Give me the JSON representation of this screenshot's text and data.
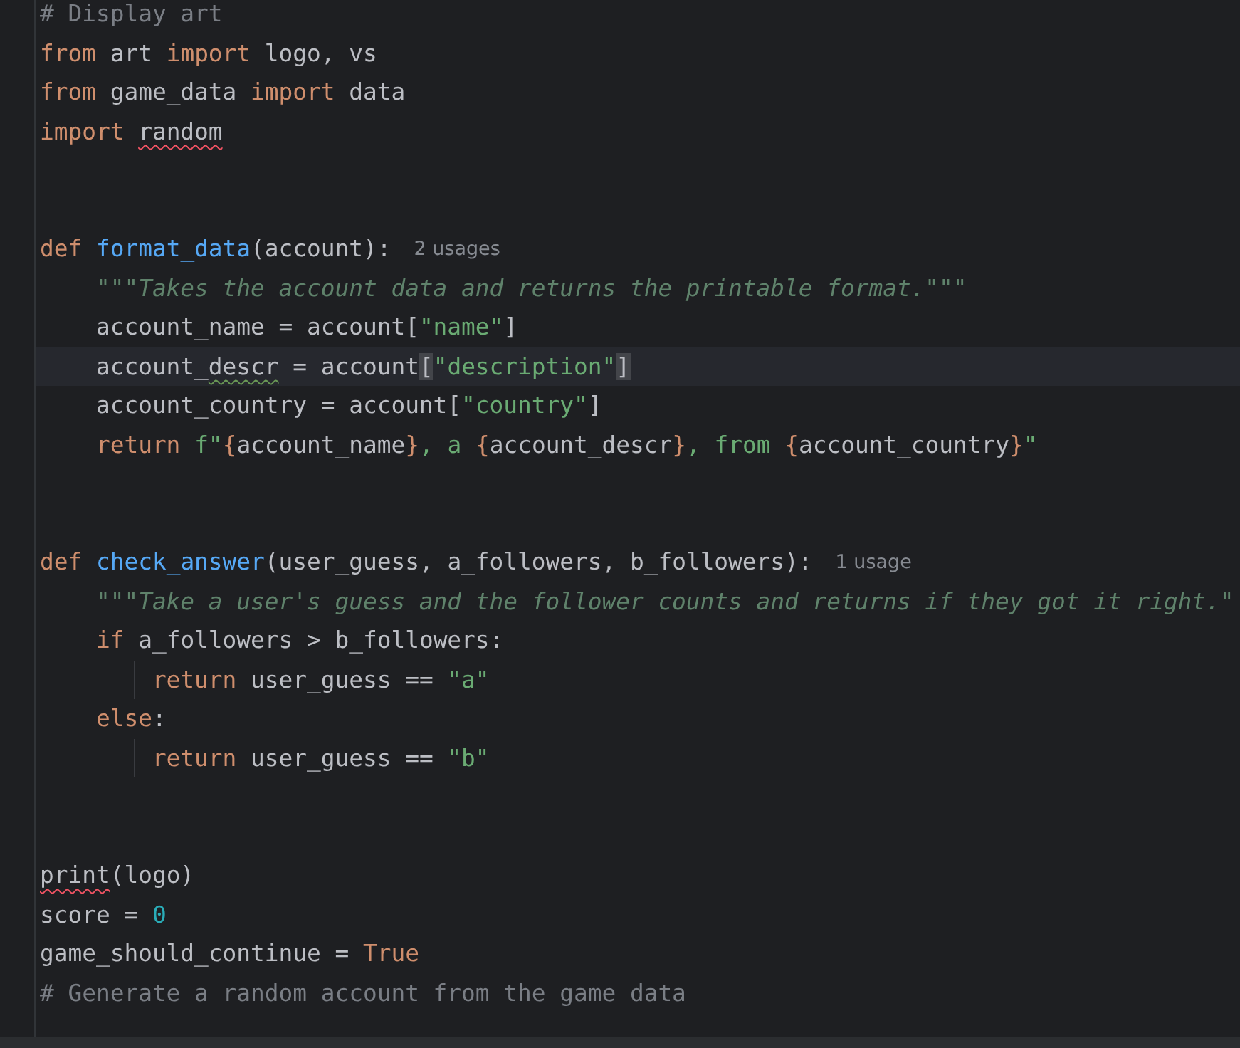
{
  "editor": {
    "lines": [
      {
        "kind": "code",
        "tokens": [
          {
            "kind": "comment",
            "text": "# Display art"
          }
        ]
      },
      {
        "kind": "code",
        "tokens": [
          {
            "kind": "keyword",
            "text": "from"
          },
          {
            "kind": "plain",
            "text": " art "
          },
          {
            "kind": "keyword",
            "text": "import"
          },
          {
            "kind": "plain",
            "text": " logo, vs"
          }
        ]
      },
      {
        "kind": "code",
        "tokens": [
          {
            "kind": "keyword",
            "text": "from"
          },
          {
            "kind": "plain",
            "text": " game_data "
          },
          {
            "kind": "keyword",
            "text": "import"
          },
          {
            "kind": "plain",
            "text": " data"
          }
        ]
      },
      {
        "kind": "code",
        "tokens": [
          {
            "kind": "keyword",
            "text": "import "
          },
          {
            "kind": "plain",
            "text": "random",
            "error": true
          }
        ]
      },
      {
        "kind": "blank"
      },
      {
        "kind": "blank"
      },
      {
        "kind": "code",
        "tokens": [
          {
            "kind": "keyword",
            "text": "def "
          },
          {
            "kind": "function",
            "text": "format_data"
          },
          {
            "kind": "plain",
            "text": "(account):"
          }
        ],
        "hint": "2 usages"
      },
      {
        "kind": "code",
        "tokens": [
          {
            "kind": "docstring",
            "text": "    \"\"\"Takes the account data and returns the printable format.\"\"\""
          }
        ]
      },
      {
        "kind": "code",
        "tokens": [
          {
            "kind": "plain",
            "text": "    account_name = account["
          },
          {
            "kind": "string",
            "text": "\"name\""
          },
          {
            "kind": "plain",
            "text": "]"
          }
        ]
      },
      {
        "kind": "code",
        "current": true,
        "tokens": [
          {
            "kind": "plain",
            "text": "    account_"
          },
          {
            "kind": "plain",
            "text": "descr",
            "warning": true
          },
          {
            "kind": "plain",
            "text": " = account"
          },
          {
            "kind": "matched",
            "text": "["
          },
          {
            "kind": "string",
            "text": "\"description\""
          },
          {
            "kind": "matched",
            "text": "]"
          }
        ]
      },
      {
        "kind": "code",
        "tokens": [
          {
            "kind": "plain",
            "text": "    account_country = account["
          },
          {
            "kind": "string",
            "text": "\"country\""
          },
          {
            "kind": "plain",
            "text": "]"
          }
        ]
      },
      {
        "kind": "code",
        "tokens": [
          {
            "kind": "keyword",
            "text": "    return "
          },
          {
            "kind": "string",
            "text": "f\""
          },
          {
            "kind": "brace",
            "text": "{"
          },
          {
            "kind": "plain",
            "text": "account_name"
          },
          {
            "kind": "brace",
            "text": "}"
          },
          {
            "kind": "string",
            "text": ", a "
          },
          {
            "kind": "brace",
            "text": "{"
          },
          {
            "kind": "plain",
            "text": "account_descr"
          },
          {
            "kind": "brace",
            "text": "}"
          },
          {
            "kind": "string",
            "text": ", from "
          },
          {
            "kind": "brace",
            "text": "{"
          },
          {
            "kind": "plain",
            "text": "account_country"
          },
          {
            "kind": "brace",
            "text": "}"
          },
          {
            "kind": "string",
            "text": "\""
          }
        ]
      },
      {
        "kind": "blank"
      },
      {
        "kind": "blank"
      },
      {
        "kind": "code",
        "tokens": [
          {
            "kind": "keyword",
            "text": "def "
          },
          {
            "kind": "function",
            "text": "check_answer"
          },
          {
            "kind": "plain",
            "text": "(user_guess, a_followers, b_followers):"
          }
        ],
        "hint": "1 usage"
      },
      {
        "kind": "code",
        "tokens": [
          {
            "kind": "docstring",
            "text": "    \"\"\"Take a user's guess and the follower counts and returns if they got it right.\""
          }
        ]
      },
      {
        "kind": "code",
        "tokens": [
          {
            "kind": "keyword",
            "text": "    if"
          },
          {
            "kind": "plain",
            "text": " a_followers > b_followers:"
          }
        ]
      },
      {
        "kind": "code",
        "guide": true,
        "tokens": [
          {
            "kind": "keyword",
            "text": "        return"
          },
          {
            "kind": "plain",
            "text": " user_guess == "
          },
          {
            "kind": "string",
            "text": "\"a\""
          }
        ]
      },
      {
        "kind": "code",
        "tokens": [
          {
            "kind": "keyword",
            "text": "    else"
          },
          {
            "kind": "plain",
            "text": ":"
          }
        ]
      },
      {
        "kind": "code",
        "guide": true,
        "tokens": [
          {
            "kind": "keyword",
            "text": "        return"
          },
          {
            "kind": "plain",
            "text": " user_guess == "
          },
          {
            "kind": "string",
            "text": "\"b\""
          }
        ]
      },
      {
        "kind": "blank"
      },
      {
        "kind": "blank"
      },
      {
        "kind": "code",
        "tokens": [
          {
            "kind": "plain",
            "text": "print",
            "error": true
          },
          {
            "kind": "plain",
            "text": "(logo)"
          }
        ]
      },
      {
        "kind": "code",
        "tokens": [
          {
            "kind": "plain",
            "text": "score = "
          },
          {
            "kind": "number",
            "text": "0"
          }
        ]
      },
      {
        "kind": "code",
        "tokens": [
          {
            "kind": "plain",
            "text": "game_should_continue = "
          },
          {
            "kind": "keyword",
            "text": "True"
          }
        ]
      },
      {
        "kind": "code",
        "tokens": [
          {
            "kind": "comment",
            "text": "# Generate a random account from the game data"
          }
        ]
      }
    ]
  }
}
